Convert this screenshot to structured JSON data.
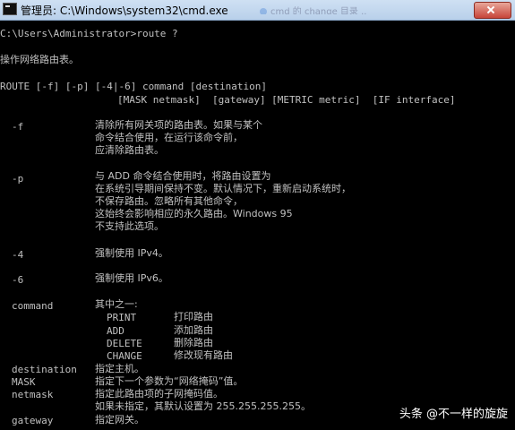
{
  "window": {
    "title": "管理员: C:\\Windows\\system32\\cmd.exe",
    "ghost_tab": "cmd 的 change 目录 ..."
  },
  "console": {
    "prompt": "C:\\Users\\Administrator>route ?",
    "desc": "操作网络路由表。",
    "usage1": "ROUTE [-f] [-p] [-4|-6] command [destination]",
    "usage2": "[MASK netmask]  [gateway] [METRIC metric]  [IF interface]",
    "options": [
      {
        "flag": "-f",
        "lines": [
          "清除所有网关项的路由表。如果与某个",
          "命令结合使用，在运行该命令前，",
          "应清除路由表。"
        ]
      },
      {
        "flag": "-p",
        "lines": [
          "与 ADD 命令结合使用时，将路由设置为",
          "在系统引导期间保持不变。默认情况下，重新启动系统时，",
          "不保存路由。忽略所有其他命令，",
          "这始终会影响相应的永久路由。Windows 95",
          "不支持此选项。"
        ]
      },
      {
        "flag": "-4",
        "lines": [
          "强制使用 IPv4。"
        ]
      },
      {
        "flag": "-6",
        "lines": [
          "强制使用 IPv6。"
        ]
      }
    ],
    "command": {
      "flag": "command",
      "intro": "其中之一:",
      "items": [
        {
          "name": "PRINT",
          "desc": "打印路由"
        },
        {
          "name": "ADD",
          "desc": "添加路由"
        },
        {
          "name": "DELETE",
          "desc": "删除路由"
        },
        {
          "name": "CHANGE",
          "desc": "修改现有路由"
        }
      ]
    },
    "tail": [
      {
        "flag": "destination",
        "text": "指定主机。"
      },
      {
        "flag": "MASK",
        "text": "指定下一个参数为“网络掩码”值。"
      },
      {
        "flag": "netmask",
        "text": "指定此路由项的子网掩码值。"
      },
      {
        "flag": "",
        "text": "如果未指定，其默认设置为 255.255.255.255。"
      },
      {
        "flag": "gateway",
        "text": "指定网关。"
      }
    ]
  },
  "watermark": "头条 @不一样的旋旋"
}
